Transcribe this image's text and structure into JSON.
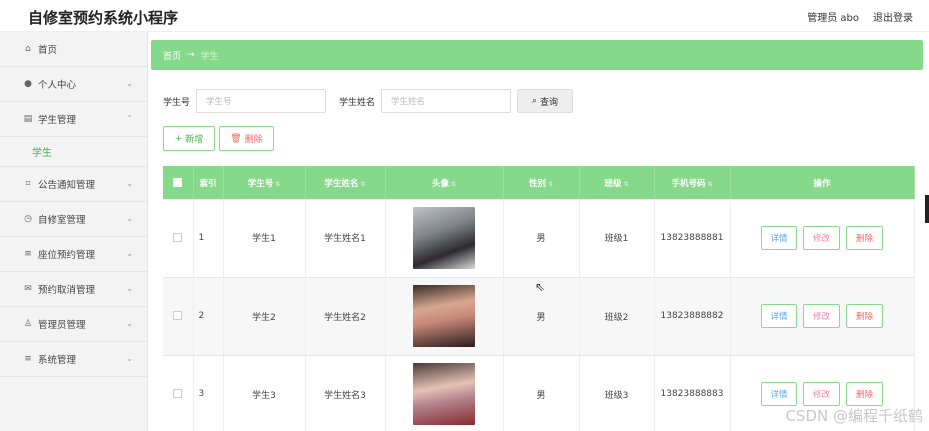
{
  "app": {
    "title": "自修室预约系统小程序"
  },
  "header": {
    "admin_label": "管理员 abo",
    "logout_label": "退出登录"
  },
  "sidebar": {
    "items": [
      {
        "icon": "home-icon",
        "label": "首页"
      },
      {
        "icon": "user-icon",
        "label": "个人中心"
      },
      {
        "icon": "list-icon",
        "label": "学生管理"
      },
      {
        "icon": "notice-icon",
        "label": "公告通知管理"
      },
      {
        "icon": "clock-icon",
        "label": "自修室管理"
      },
      {
        "icon": "menu-icon",
        "label": "座位预约管理"
      },
      {
        "icon": "mail-icon",
        "label": "预约取消管理"
      },
      {
        "icon": "admin-icon",
        "label": "管理员管理"
      },
      {
        "icon": "menu-icon",
        "label": "系统管理"
      }
    ],
    "sub_active": "学生"
  },
  "breadcrumb": {
    "home": "首页",
    "sep": "→",
    "current": "学生"
  },
  "search": {
    "field1_label": "学生号",
    "field1_placeholder": "学生号",
    "field2_label": "学生姓名",
    "field2_placeholder": "学生姓名",
    "button": "查询"
  },
  "actions": {
    "add": "新增",
    "delete": "删除"
  },
  "table": {
    "headers": [
      "索引",
      "学生号",
      "学生姓名",
      "头像",
      "性别",
      "班级",
      "手机号码",
      "操作"
    ],
    "rows": [
      {
        "index": "1",
        "student_no": "学生1",
        "name": "学生姓名1",
        "gender": "男",
        "class": "班级1",
        "phone": "13823888881"
      },
      {
        "index": "2",
        "student_no": "学生2",
        "name": "学生姓名2",
        "gender": "男",
        "class": "班级2",
        "phone": "13823888882"
      },
      {
        "index": "3",
        "student_no": "学生3",
        "name": "学生姓名3",
        "gender": "男",
        "class": "班级3",
        "phone": "13823888883"
      }
    ],
    "row_ops": {
      "detail": "详情",
      "edit": "修改",
      "delete": "删除"
    }
  },
  "watermark": "CSDN @编程千纸鹤",
  "colors": {
    "accent": "#86d98a",
    "accent_text": "#4caf50",
    "danger": "#f06a6a",
    "info": "#5aa8e8"
  }
}
